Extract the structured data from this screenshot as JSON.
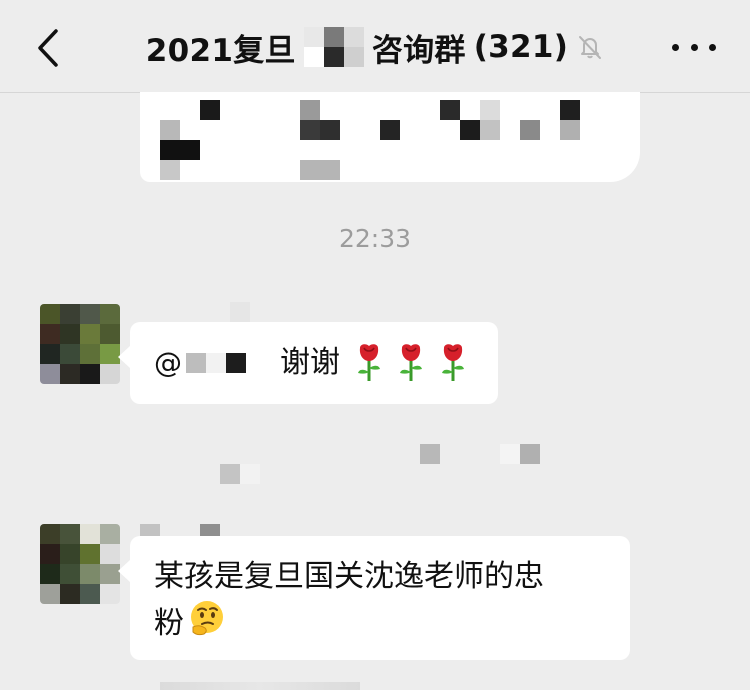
{
  "header": {
    "title": "2021复旦",
    "title_suffix": "咨询群",
    "member_count": "(321)"
  },
  "timestamp": "22:33",
  "messages": [
    {
      "text": "谢谢",
      "reactions": [
        "rose-icon",
        "rose-icon",
        "rose-icon"
      ]
    },
    {
      "line1": "某孩是复旦国关沈逸老师的忠",
      "line2": "粉",
      "emoji": "thinking-face-icon"
    }
  ],
  "colors": {
    "background": "#ededed",
    "bubble": "#ffffff",
    "timestamp": "#9c9c9c"
  }
}
